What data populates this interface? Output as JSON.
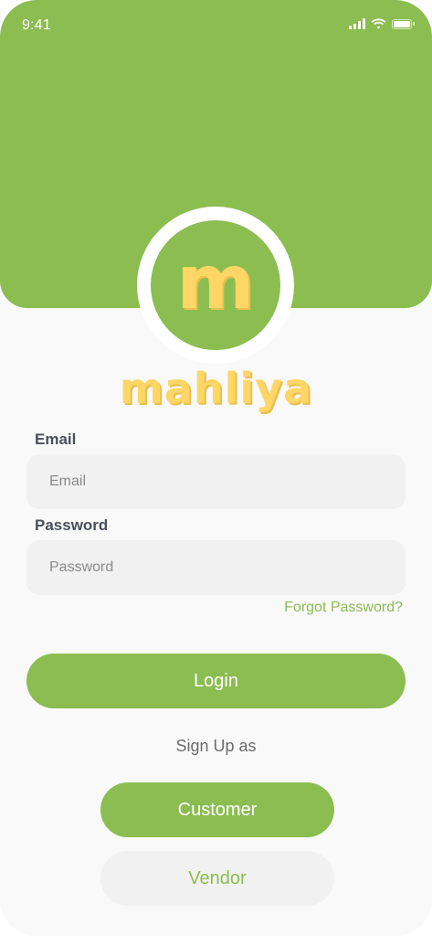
{
  "status_bar": {
    "time": "9:41"
  },
  "brand": {
    "logo_letter": "m",
    "name": "mahliya"
  },
  "form": {
    "email_label": "Email",
    "email_placeholder": "Email",
    "password_label": "Password",
    "password_placeholder": "Password",
    "forgot_password": "Forgot Password?",
    "login_label": "Login"
  },
  "signup": {
    "prompt": "Sign Up as",
    "customer_label": "Customer",
    "vendor_label": "Vendor"
  },
  "colors": {
    "primary_green": "#8bbd51",
    "brand_yellow": "#fdd666",
    "field_background": "#f1f1f1",
    "page_background": "#f9f9f9"
  },
  "icons": [
    "cellular-signal-icon",
    "wifi-icon",
    "battery-icon"
  ]
}
